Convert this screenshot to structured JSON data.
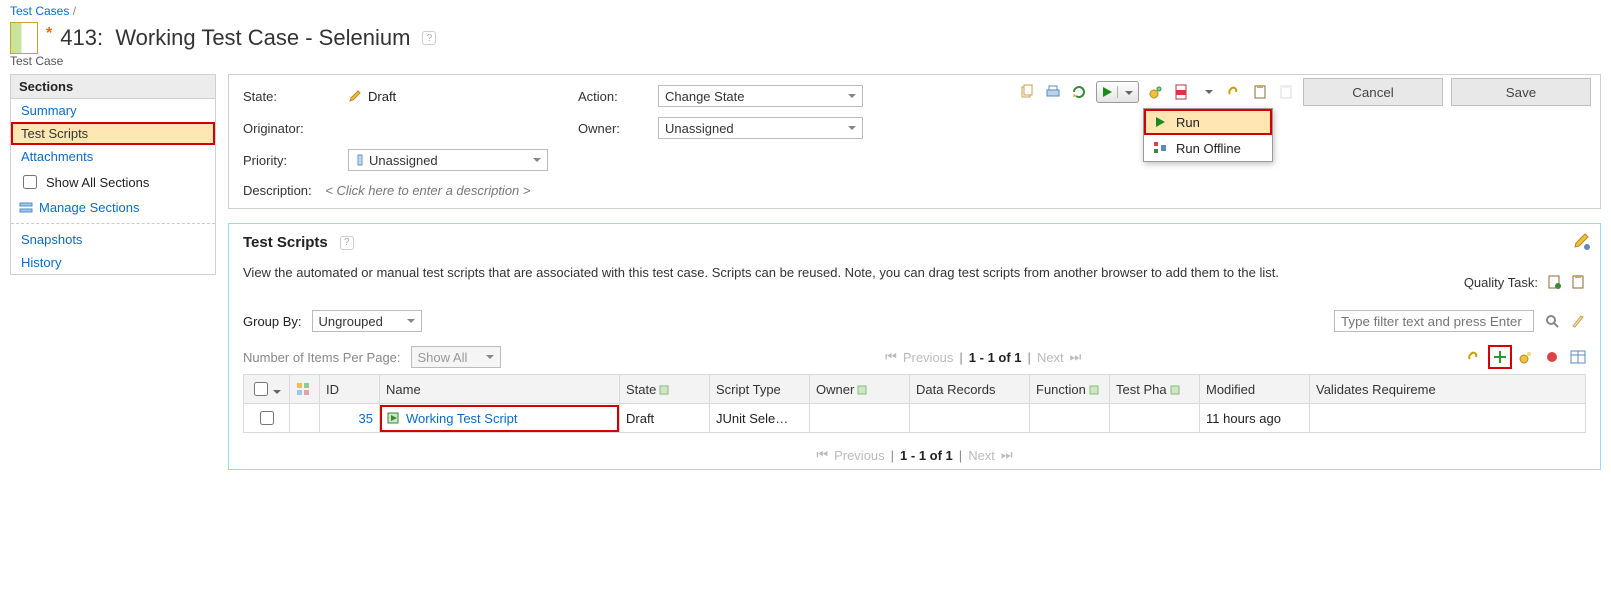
{
  "breadcrumb": {
    "parent": "Test Cases",
    "sep": "/"
  },
  "title": {
    "id": "413",
    "sep": ":",
    "name": "Working Test Case - Selenium",
    "modified": "*"
  },
  "subtitle": "Test Case",
  "buttons": {
    "cancel": "Cancel",
    "save": "Save"
  },
  "runMenu": {
    "run": "Run",
    "runOffline": "Run Offline"
  },
  "sidebar": {
    "heading": "Sections",
    "items": [
      "Summary",
      "Test Scripts",
      "Attachments"
    ],
    "activeIndex": 1,
    "showAll": "Show All Sections",
    "manage": "Manage Sections",
    "bottom": [
      "Snapshots",
      "History"
    ]
  },
  "form": {
    "state_label": "State:",
    "state_value": "Draft",
    "action_label": "Action:",
    "action_value": "Change State",
    "originator_label": "Originator:",
    "owner_label": "Owner:",
    "owner_value": "Unassigned",
    "priority_label": "Priority:",
    "priority_value": "Unassigned",
    "desc_label": "Description:",
    "desc_placeholder": "< Click here to enter a description >"
  },
  "scripts": {
    "heading": "Test Scripts",
    "help": "?",
    "desc": "View the automated or manual test scripts that are associated with this test case. Scripts can be reused. Note, you can drag test scripts from another browser to add them to the list.",
    "quality_label": "Quality Task:",
    "groupby_label": "Group By:",
    "groupby_value": "Ungrouped",
    "perpage_label": "Number of Items Per Page:",
    "perpage_value": "Show All",
    "filter_placeholder": "Type filter text and press Enter",
    "pager_prev": "Previous",
    "pager_next": "Next",
    "pager_range": "1 - 1 of 1",
    "columns": [
      "",
      "",
      "ID",
      "Name",
      "State",
      "Script Type",
      "Owner",
      "Data Records",
      "Function",
      "Test Pha",
      "Modified",
      "Validates Requireme"
    ],
    "row": {
      "id": "35",
      "name": "Working Test Script",
      "state": "Draft",
      "scriptType": "JUnit Sele…",
      "modified": "11 hours ago"
    }
  }
}
